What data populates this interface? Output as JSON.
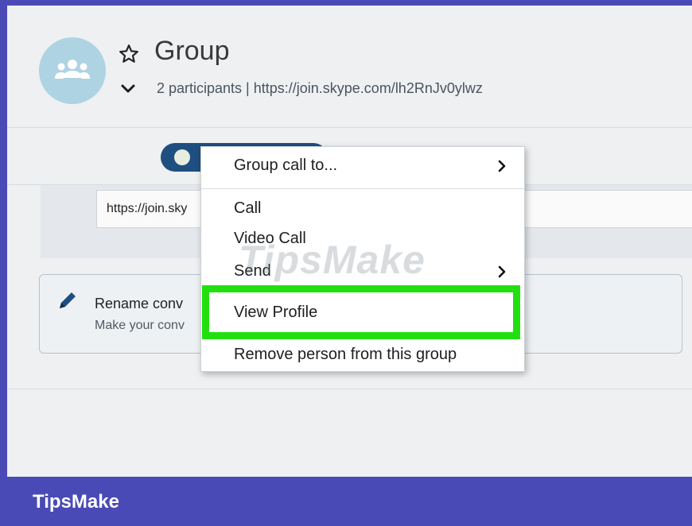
{
  "header": {
    "title": "Group",
    "subtitle": "2 participants  |  https://join.skype.com/lh2RnJv0ylwz",
    "avatar_icon": "group-people-icon",
    "star_icon": "star-outline-icon",
    "expand_icon": "chevron-down-icon"
  },
  "link_panel": {
    "link_text": "https://join.sky"
  },
  "rename_card": {
    "title": "Rename conv",
    "subtitle": "Make your conv",
    "icon": "pencil-icon"
  },
  "context_menu": {
    "items": [
      {
        "label": "Group call to...",
        "has_submenu": true
      },
      {
        "label": "Call",
        "has_submenu": false
      },
      {
        "label": "Video Call",
        "has_submenu": false
      },
      {
        "label": "Send",
        "has_submenu": true
      },
      {
        "label": "View Profile",
        "has_submenu": false,
        "highlighted": true
      },
      {
        "label": "Remove person from this group",
        "has_submenu": false
      }
    ]
  },
  "watermark": "TipsMake",
  "footer": {
    "brand": "TipsMake"
  },
  "colors": {
    "frame": "#4a4ab6",
    "highlight": "#22e010",
    "pill": "#1e4f80",
    "avatar": "#aed3e3"
  }
}
